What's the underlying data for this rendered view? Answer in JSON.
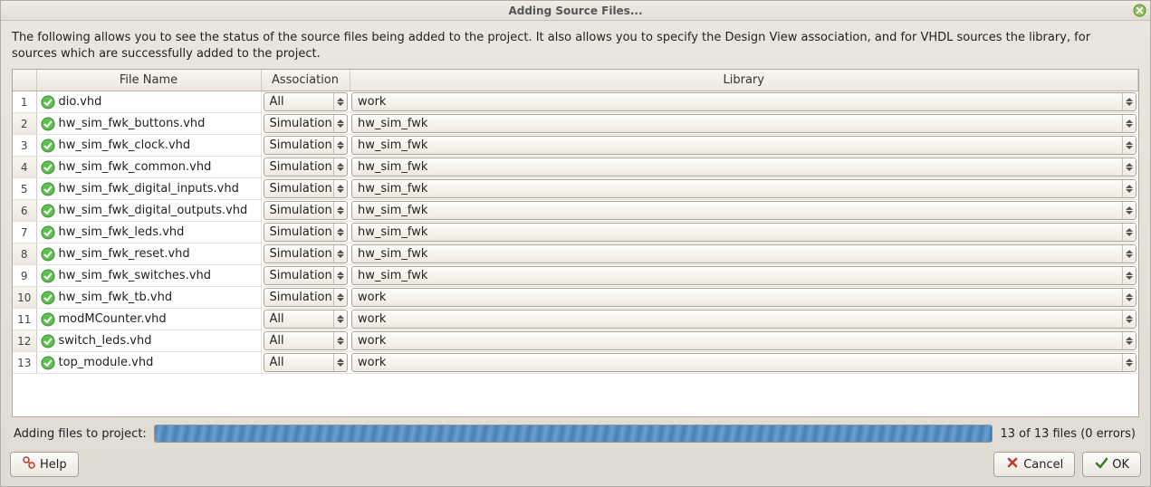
{
  "window": {
    "title": "Adding Source Files..."
  },
  "description": "The following allows you to see the status of the source files being added to the project.  It also allows you to specify the Design View association, and for VHDL sources the library, for sources which are successfully added to the project.",
  "columns": {
    "file": "File Name",
    "assoc": "Association",
    "lib": "Library"
  },
  "rows": [
    {
      "n": "1",
      "file": "dio.vhd",
      "assoc": "All",
      "lib": "work"
    },
    {
      "n": "2",
      "file": "hw_sim_fwk_buttons.vhd",
      "assoc": "Simulation",
      "lib": "hw_sim_fwk"
    },
    {
      "n": "3",
      "file": "hw_sim_fwk_clock.vhd",
      "assoc": "Simulation",
      "lib": "hw_sim_fwk"
    },
    {
      "n": "4",
      "file": "hw_sim_fwk_common.vhd",
      "assoc": "Simulation",
      "lib": "hw_sim_fwk"
    },
    {
      "n": "5",
      "file": "hw_sim_fwk_digital_inputs.vhd",
      "assoc": "Simulation",
      "lib": "hw_sim_fwk"
    },
    {
      "n": "6",
      "file": "hw_sim_fwk_digital_outputs.vhd",
      "assoc": "Simulation",
      "lib": "hw_sim_fwk"
    },
    {
      "n": "7",
      "file": "hw_sim_fwk_leds.vhd",
      "assoc": "Simulation",
      "lib": "hw_sim_fwk"
    },
    {
      "n": "8",
      "file": "hw_sim_fwk_reset.vhd",
      "assoc": "Simulation",
      "lib": "hw_sim_fwk"
    },
    {
      "n": "9",
      "file": "hw_sim_fwk_switches.vhd",
      "assoc": "Simulation",
      "lib": "hw_sim_fwk"
    },
    {
      "n": "10",
      "file": "hw_sim_fwk_tb.vhd",
      "assoc": "Simulation",
      "lib": "work"
    },
    {
      "n": "11",
      "file": "modMCounter.vhd",
      "assoc": "All",
      "lib": "work"
    },
    {
      "n": "12",
      "file": "switch_leds.vhd",
      "assoc": "All",
      "lib": "work"
    },
    {
      "n": "13",
      "file": "top_module.vhd",
      "assoc": "All",
      "lib": "work"
    }
  ],
  "progress": {
    "label": "Adding files to project:",
    "status": "13 of 13 files (0 errors)"
  },
  "buttons": {
    "help": "Help",
    "cancel": "Cancel",
    "ok": "OK"
  }
}
